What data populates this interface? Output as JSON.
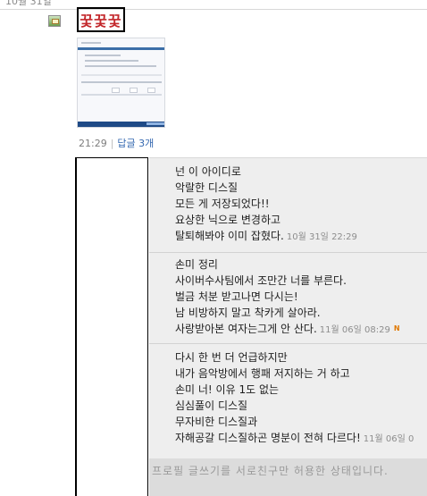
{
  "post": {
    "date": "10월 31일",
    "logo_text": "꿏꿏꿏",
    "time": "21:29",
    "reply_count_label": "답글 3개"
  },
  "replies": [
    {
      "lines": [
        "넌 이 아이디로",
        "악랄한 디스질",
        "모든 게 저장되었다!!",
        "요상한 닉으로 변경하고",
        "탈퇴해봐야 이미 잡혔다."
      ],
      "timestamp": "10월 31일 22:29"
    },
    {
      "lines": [
        "손미 정리",
        "사이버수사팀에서 조만간 너를 부른다.",
        "벌금 처분 받고나면 다시는!",
        "남 비방하지 말고 착카게 살아라.",
        "사랑받아본 여자는그게 안 산다."
      ],
      "timestamp": "11월 06일 08:29",
      "new_mark": "N"
    },
    {
      "lines": [
        "다시 한 번 더 언급하지만",
        "내가 음악방에서 행패 저지하는 거 하고",
        "손미 너! 이유 1도 없는",
        "심심풀이 디스질",
        "무자비한 디스질과",
        "자해공갈 디스질하곤 명분이 전혀 다르다!"
      ],
      "timestamp": "11월 06일 0"
    }
  ],
  "notice": "프로필 글쓰기를 서로친구만 허용한 상태입니다."
}
